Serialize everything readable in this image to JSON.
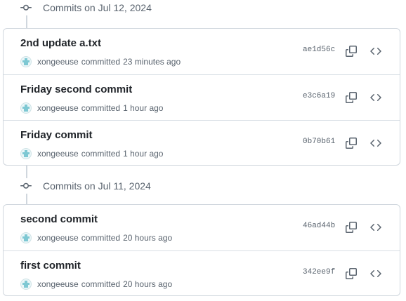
{
  "groups": [
    {
      "title": "Commits on Jul 12, 2024",
      "commits": [
        {
          "message": "2nd update a.txt",
          "author": "xongeeuse",
          "verb": "committed",
          "time": "23 minutes ago",
          "sha": "ae1d56c"
        },
        {
          "message": "Friday second commit",
          "author": "xongeeuse",
          "verb": "committed",
          "time": "1 hour ago",
          "sha": "e3c6a19"
        },
        {
          "message": "Friday commit",
          "author": "xongeeuse",
          "verb": "committed",
          "time": "1 hour ago",
          "sha": "0b70b61"
        }
      ]
    },
    {
      "title": "Commits on Jul 11, 2024",
      "commits": [
        {
          "message": "second commit",
          "author": "xongeeuse",
          "verb": "committed",
          "time": "20 hours ago",
          "sha": "46ad44b"
        },
        {
          "message": "first commit",
          "author": "xongeeuse",
          "verb": "committed",
          "time": "20 hours ago",
          "sha": "342ee9f"
        }
      ]
    }
  ],
  "icons": {
    "commit_node": "git-commit-icon",
    "avatar": "avatar",
    "copy": "copy-icon",
    "browse": "code-icon"
  },
  "colors": {
    "text": "#1f2328",
    "muted": "#59636e",
    "border": "#d0d7de",
    "avatar_fill": "#7ec8d3"
  }
}
